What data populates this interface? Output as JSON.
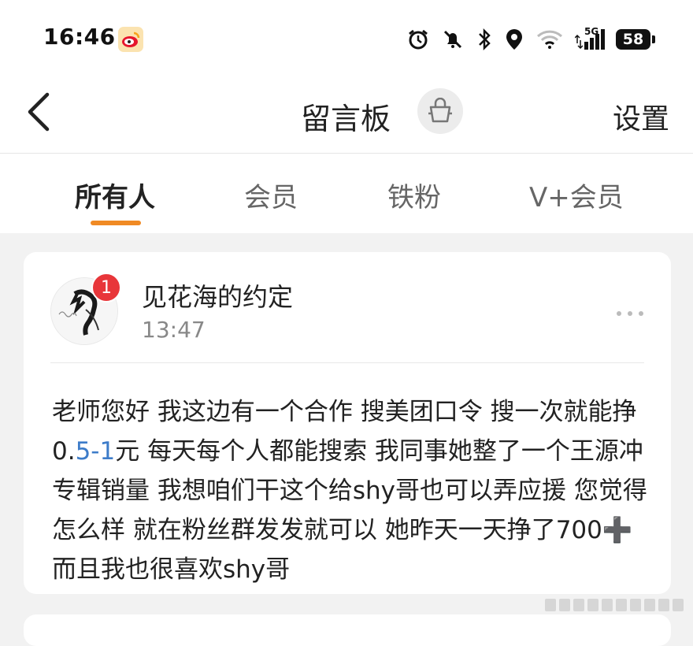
{
  "status_bar": {
    "time": "16:46",
    "network": "5G",
    "battery": "58"
  },
  "nav": {
    "back_icon": "chevron-left-icon",
    "title": "留言板",
    "settings_label": "设置"
  },
  "tabs": [
    {
      "label": "所有人",
      "active": true
    },
    {
      "label": "会员",
      "active": false
    },
    {
      "label": "铁粉",
      "active": false
    },
    {
      "label": "V+会员",
      "active": false
    }
  ],
  "post": {
    "author": "见花海的约定",
    "time": "13:47",
    "badge_count": "1",
    "content_parts": [
      "老师您好 我这边有一个合作 搜美团口令 搜一次就能挣0.",
      "5-1",
      "元 每天每个人都能搜索 我同事她整了一个王源冲专辑销量 我想咱们干这个给shy哥也可以弄应援 您觉得怎么样 就在粉丝群发发就可以 她昨天一天挣了700",
      "➕",
      " 而且我也很喜欢shy哥"
    ]
  },
  "colors": {
    "accent": "#f08a24",
    "badge": "#e8363a",
    "link": "#3d7cc9",
    "background": "#f2f2f2"
  }
}
